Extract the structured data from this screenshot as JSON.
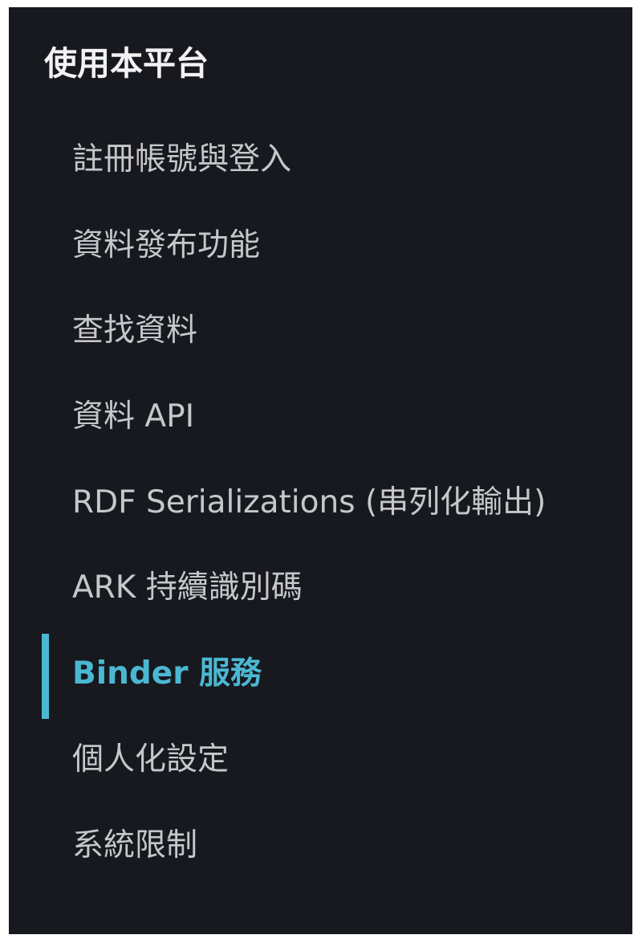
{
  "section": {
    "title": "使用本平台"
  },
  "nav": {
    "items": [
      {
        "label": "註冊帳號與登入"
      },
      {
        "label": "資料發布功能"
      },
      {
        "label": "查找資料"
      },
      {
        "label": "資料 API"
      },
      {
        "label": "RDF Serializations (串列化輸出)"
      },
      {
        "label": "ARK 持續識別碼"
      },
      {
        "label": "Binder 服務"
      },
      {
        "label": "個人化設定"
      },
      {
        "label": "系統限制"
      }
    ],
    "active_index": 6
  },
  "colors": {
    "background": "#17191f",
    "text": "#c6c7cb",
    "heading": "#f2f2f2",
    "accent": "#4bb8d2"
  }
}
